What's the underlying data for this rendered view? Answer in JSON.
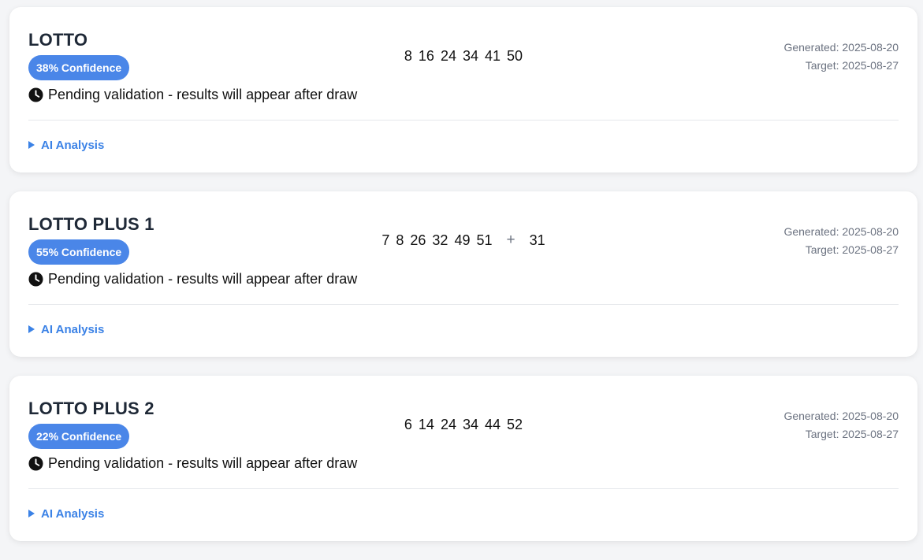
{
  "cards": [
    {
      "title": "LOTTO",
      "confidence": "38% Confidence",
      "status": "Pending validation - results will appear after draw",
      "numbers": [
        "8",
        "16",
        "24",
        "34",
        "41",
        "50"
      ],
      "bonus_separator": "",
      "bonus": "",
      "generated": "Generated: 2025-08-20",
      "target": "Target: 2025-08-27",
      "analysis_label": "AI Analysis"
    },
    {
      "title": "LOTTO PLUS 1",
      "confidence": "55% Confidence",
      "status": "Pending validation - results will appear after draw",
      "numbers": [
        "7",
        "8",
        "26",
        "32",
        "49",
        "51"
      ],
      "bonus_separator": "+",
      "bonus": "31",
      "generated": "Generated: 2025-08-20",
      "target": "Target: 2025-08-27",
      "analysis_label": "AI Analysis"
    },
    {
      "title": "LOTTO PLUS 2",
      "confidence": "22% Confidence",
      "status": "Pending validation - results will appear after draw",
      "numbers": [
        "6",
        "14",
        "24",
        "34",
        "44",
        "52"
      ],
      "bonus_separator": "",
      "bonus": "",
      "generated": "Generated: 2025-08-20",
      "target": "Target: 2025-08-27",
      "analysis_label": "AI Analysis"
    }
  ],
  "icons": {
    "status": "clock-icon",
    "analysis": "triangle-right-icon"
  },
  "colors": {
    "accent": "#4a86e8",
    "link": "#3b82e6",
    "muted": "#6b7280"
  }
}
